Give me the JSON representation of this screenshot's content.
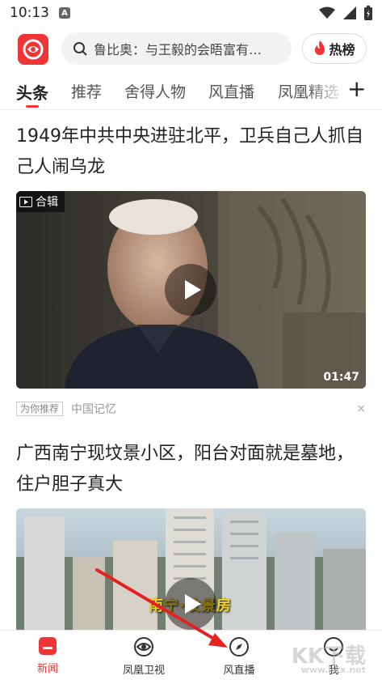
{
  "status_bar": {
    "time": "10:13",
    "badge": "A"
  },
  "header": {
    "search_placeholder": "鲁比奥：与王毅的会晤富有…",
    "hot_label": "热榜"
  },
  "tabs": [
    {
      "label": "头条",
      "active": true
    },
    {
      "label": "推荐"
    },
    {
      "label": "舍得人物"
    },
    {
      "label": "风直播"
    },
    {
      "label": "凤凰精选"
    }
  ],
  "feed": [
    {
      "title": "1949年中共中央进驻北平，卫兵自己人抓自己人闹乌龙",
      "badge": "合辑",
      "duration": "01:47",
      "tag": "为你推荐",
      "source": "中国记忆",
      "close": "×"
    },
    {
      "title": "广西南宁现坟景小区，阳台对面就是墓地，住户胆子真大",
      "overlay_caption": "南宁·坟景房"
    }
  ],
  "bottom_nav": [
    {
      "label": "新闻",
      "icon": "news-icon",
      "active": true
    },
    {
      "label": "凤凰卫视",
      "icon": "phoenix-tv-icon"
    },
    {
      "label": "风直播",
      "icon": "compass-icon"
    },
    {
      "label": "我",
      "icon": "profile-icon"
    }
  ],
  "watermark": {
    "text": "KK下载",
    "url": "www.kkx.net"
  },
  "colors": {
    "brand_red": "#ef3535",
    "text": "#222222",
    "muted": "#999999"
  }
}
